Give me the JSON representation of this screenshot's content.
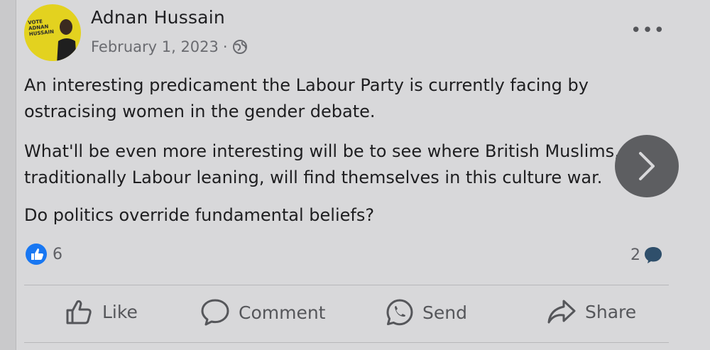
{
  "post": {
    "author": "Adnan Hussain",
    "avatar_text": "VOTE ADNAN HUSSAIN",
    "date": "February 1, 2023",
    "separator": "·",
    "privacy_icon": "globe-icon",
    "more_label": "•••",
    "paragraphs": [
      "An interesting predicament the Labour Party is currently facing by\nostracising women in the gender debate.",
      "What'll be even more interesting will be to see where British Muslims,\ntraditionally Labour leaning, will find themselves in this culture war.",
      "Do politics override fundamental beliefs?"
    ],
    "reactions_count": "6",
    "comments_count": "2"
  },
  "actions": {
    "like": "Like",
    "comment": "Comment",
    "send": "Send",
    "share": "Share"
  },
  "colors": {
    "like_blue": "#1877f2",
    "comment_bubble": "#2f4f6b"
  }
}
